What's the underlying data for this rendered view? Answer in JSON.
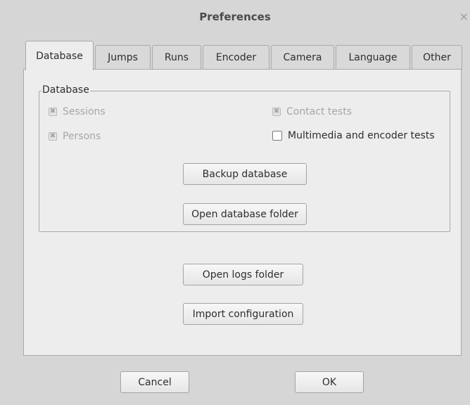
{
  "window": {
    "title": "Preferences",
    "close_glyph": "×"
  },
  "tabs": [
    {
      "label": "Database",
      "active": true
    },
    {
      "label": "Jumps"
    },
    {
      "label": "Runs"
    },
    {
      "label": "Encoder"
    },
    {
      "label": "Camera"
    },
    {
      "label": "Language"
    },
    {
      "label": "Other"
    }
  ],
  "database_frame": {
    "label": "Database",
    "checks": {
      "sessions": {
        "label": "Sessions",
        "checked": true,
        "enabled": false
      },
      "contact_tests": {
        "label": "Contact tests",
        "checked": true,
        "enabled": false
      },
      "persons": {
        "label": "Persons",
        "checked": true,
        "enabled": false
      },
      "multimedia": {
        "label": "Multimedia and encoder tests",
        "checked": false,
        "enabled": true
      }
    },
    "backup_button": "Backup database",
    "open_folder_button": "Open database folder"
  },
  "open_logs_button": "Open logs folder",
  "import_config_button": "Import configuration",
  "footer": {
    "cancel": "Cancel",
    "ok": "OK"
  },
  "icons": {
    "close": "close-icon",
    "checkbox_mark": "x-mark"
  }
}
